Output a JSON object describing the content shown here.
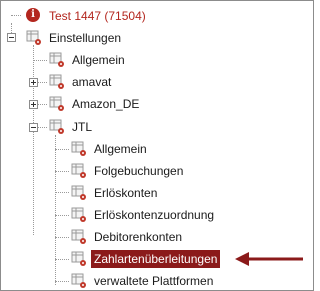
{
  "tree": {
    "root": {
      "label": "Test 1447 (71504)",
      "icon": "info-icon"
    },
    "einstellungen": {
      "label": "Einstellungen",
      "icon": "table-gear-icon"
    },
    "allgemein": {
      "label": "Allgemein"
    },
    "amavat": {
      "label": "amavat"
    },
    "amazon": {
      "label": "Amazon_DE"
    },
    "jtl": {
      "label": "JTL"
    },
    "jtl_children": [
      {
        "label": "Allgemein"
      },
      {
        "label": "Folgebuchungen"
      },
      {
        "label": "Erlöskonten"
      },
      {
        "label": "Erlöskontenzuordnung"
      },
      {
        "label": "Debitorenkonten"
      },
      {
        "label": "Zahlartenüberleitungen",
        "selected": true
      },
      {
        "label": "verwaltete Plattformen"
      }
    ]
  },
  "colors": {
    "selection": "#8b1a1a",
    "accent": "#b3261e",
    "arrow": "#8b1a1a"
  }
}
